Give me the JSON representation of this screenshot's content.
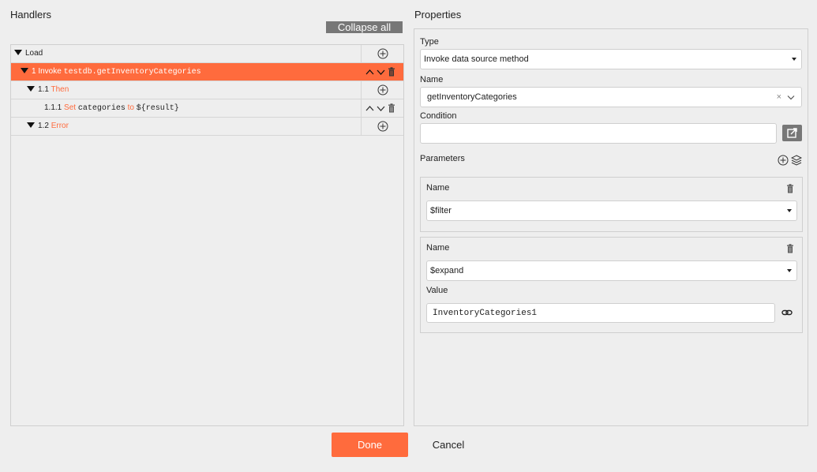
{
  "handlers": {
    "title": "Handlers",
    "collapse_all_label": "Collapse all",
    "rows": [
      {
        "number": "",
        "keyword": "Load",
        "detail": ""
      },
      {
        "number": "1",
        "keyword": "Invoke",
        "detail": "testdb.getInventoryCategories"
      },
      {
        "number": "1.1",
        "keyword": "Then",
        "detail": ""
      },
      {
        "number": "1.1.1",
        "keyword": "Set",
        "var": "categories",
        "to_word": "to",
        "value": "${result}"
      },
      {
        "number": "1.2",
        "keyword": "Error",
        "detail": ""
      }
    ]
  },
  "properties": {
    "title": "Properties",
    "type_label": "Type",
    "type_value": "Invoke data source method",
    "name_label": "Name",
    "name_value": "getInventoryCategories",
    "name_clear": "×",
    "condition_label": "Condition",
    "condition_value": "",
    "parameters_label": "Parameters",
    "params": [
      {
        "name_label": "Name",
        "name_value": "$filter"
      },
      {
        "name_label": "Name",
        "name_value": "$expand",
        "value_label": "Value",
        "value_value": "InventoryCategories1"
      }
    ]
  },
  "footer": {
    "done_label": "Done",
    "cancel_label": "Cancel"
  },
  "colors": {
    "accent": "#ff6b3d",
    "secondary_button": "#777777",
    "background": "#eeeeee"
  }
}
